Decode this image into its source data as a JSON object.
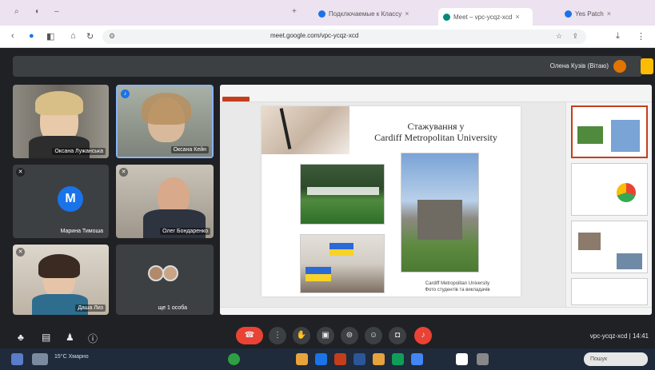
{
  "browser": {
    "tabs": [
      {
        "label": "Подключаемые к Классу",
        "color": "#1a73e8",
        "active": false
      },
      {
        "label": "Meet – vpc-ycqz-xcd",
        "color": "#00897b",
        "active": true
      },
      {
        "label": "Yes Patch",
        "color": "#1a73e8",
        "active": false
      }
    ],
    "url": "meet.google.com/vpc-ycqz-xcd",
    "nav_icons": [
      "back-icon",
      "forward-icon",
      "reload-icon",
      "home-icon"
    ]
  },
  "meet": {
    "presenter_label": "Олена Кузів (Вітаю)",
    "participants": [
      {
        "name": "Оксана Лужанська",
        "kind": "video",
        "muted": false
      },
      {
        "name": "Оксана Кейн",
        "kind": "video",
        "muted": true
      },
      {
        "name": "Марина Тимоша",
        "kind": "avatar",
        "initial": "M",
        "muted": true
      },
      {
        "name": "Олег Бондаренко",
        "kind": "video",
        "muted": true
      },
      {
        "name": "Даша Лиз",
        "kind": "video",
        "muted": true
      },
      {
        "name": "ще 1 особа",
        "kind": "group",
        "muted": false
      }
    ],
    "meeting_code": "vpc-ycqz-xcd",
    "time": "14:41"
  },
  "slide": {
    "title_line1": "Стажування у",
    "title_line2": "Cardiff Metropolitan University",
    "caption_line1": "Cardiff Metropolitan University",
    "caption_line2": "Фото студентів та викладачів"
  },
  "taskbar": {
    "weather": "15°C Хмарно",
    "search_placeholder": "Пошук"
  },
  "colors": {
    "meet_bg": "#202124",
    "end_call": "#ea4335",
    "accent_yellow": "#fbbc04",
    "pp_red": "#c43e1c"
  }
}
